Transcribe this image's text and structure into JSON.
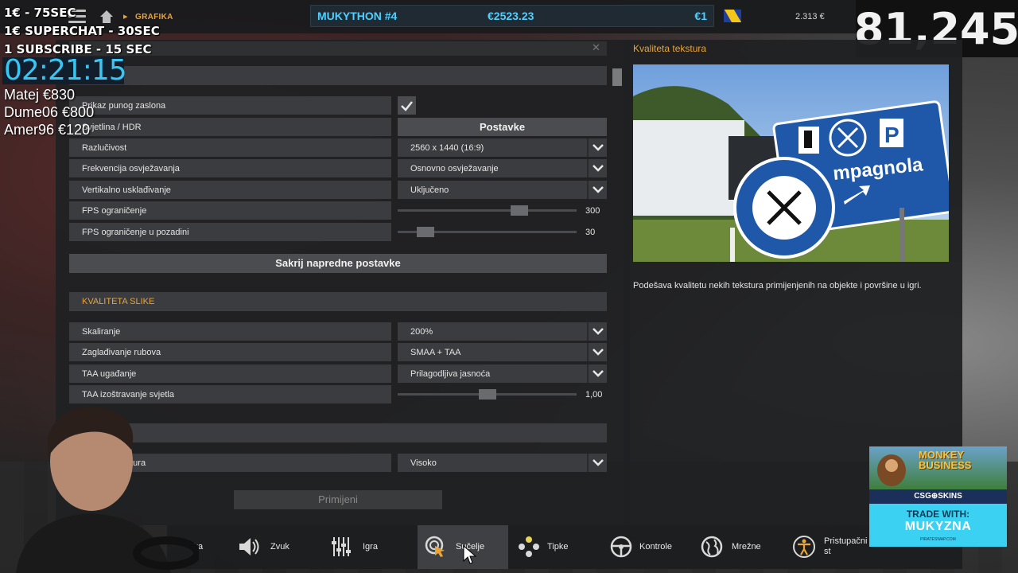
{
  "overlay": {
    "line1": "1€ - 75SEC",
    "line2": "1€ SUPERCHAT - 30SEC",
    "line3": "1 SUBSCRIBE - 15 SEC",
    "timer": "02:21:15",
    "donors": [
      "Matej €830",
      "Dume06 €800",
      "Amer96 €120"
    ],
    "viewer_count": "81,245"
  },
  "topbar": {
    "breadcrumb": "GRAFIKA",
    "profile_name": "MUKYTHON #4",
    "profile_money": "€2523.23",
    "profile_small": "€1",
    "balance": "2.313 €"
  },
  "settings": {
    "rows_basic": [
      {
        "label": "Prikaz punog zaslona",
        "type": "checkbox",
        "checked": true
      },
      {
        "label": "Svjetlina / HDR",
        "type": "button",
        "value": "Postavke"
      },
      {
        "label": "Razlučivost",
        "type": "dropdown",
        "value": "2560 x 1440 (16:9)"
      },
      {
        "label": "Frekvencija osvježavanja",
        "type": "dropdown",
        "value": "Osnovno osvježavanje"
      },
      {
        "label": "Vertikalno usklađivanje",
        "type": "dropdown",
        "value": "Uključeno"
      },
      {
        "label": "FPS ograničenje",
        "type": "slider",
        "value": "300",
        "level": 0.7
      },
      {
        "label": "FPS ograničenje u pozadini",
        "type": "slider",
        "value": "30",
        "level": 0.12
      }
    ],
    "hide_advanced_button": "Sakrij napredne postavke",
    "image_quality_section": "KVALITETA SLIKE",
    "rows_quality": [
      {
        "label": "Skaliranje",
        "type": "dropdown",
        "value": "200%"
      },
      {
        "label": "Zaglađivanje rubova",
        "type": "dropdown",
        "value": "SMAA + TAA"
      },
      {
        "label": "TAA ugađanje",
        "type": "dropdown",
        "value": "Prilagodljiva jasnoća"
      },
      {
        "label": "TAA izoštravanje svjetla",
        "type": "slider",
        "value": "1,00",
        "level": 0.5
      }
    ],
    "texture_row": {
      "label": "ekstura",
      "value": "Visoko"
    },
    "apply_button": "Primijeni"
  },
  "detail": {
    "title": "Kvaliteta tekstura",
    "sign_text": "mpagnola",
    "sign_letter": "P",
    "description": "Podešava kvalitetu nekih tekstura primijenjenih na objekte i površine u igri."
  },
  "bottom_nav": [
    {
      "label": "fika",
      "icon": "graphics-icon"
    },
    {
      "label": "Zvuk",
      "icon": "speaker-icon"
    },
    {
      "label": "Igra",
      "icon": "sliders-icon"
    },
    {
      "label": "Sučelje",
      "icon": "cursor-target-icon",
      "active": true
    },
    {
      "label": "Tipke",
      "icon": "gamepad-buttons-icon"
    },
    {
      "label": "Kontrole",
      "icon": "steering-wheel-icon"
    },
    {
      "label": "Mrežne",
      "icon": "globe-icon"
    },
    {
      "label": "Pristupačni\nst",
      "icon": "accessibility-icon"
    }
  ],
  "ad": {
    "game_title_1": "MONKEY",
    "game_title_2": "BUSINESS",
    "brand": "CSG⊕SKINS",
    "line1": "TRADE WITH:",
    "line2": "MUKYZNA",
    "line3": "PIRATESWAP.COM"
  },
  "colors": {
    "accent": "#e8a53a",
    "profile_blue": "#4fd0ff",
    "timer_blue": "#38c6f2"
  }
}
